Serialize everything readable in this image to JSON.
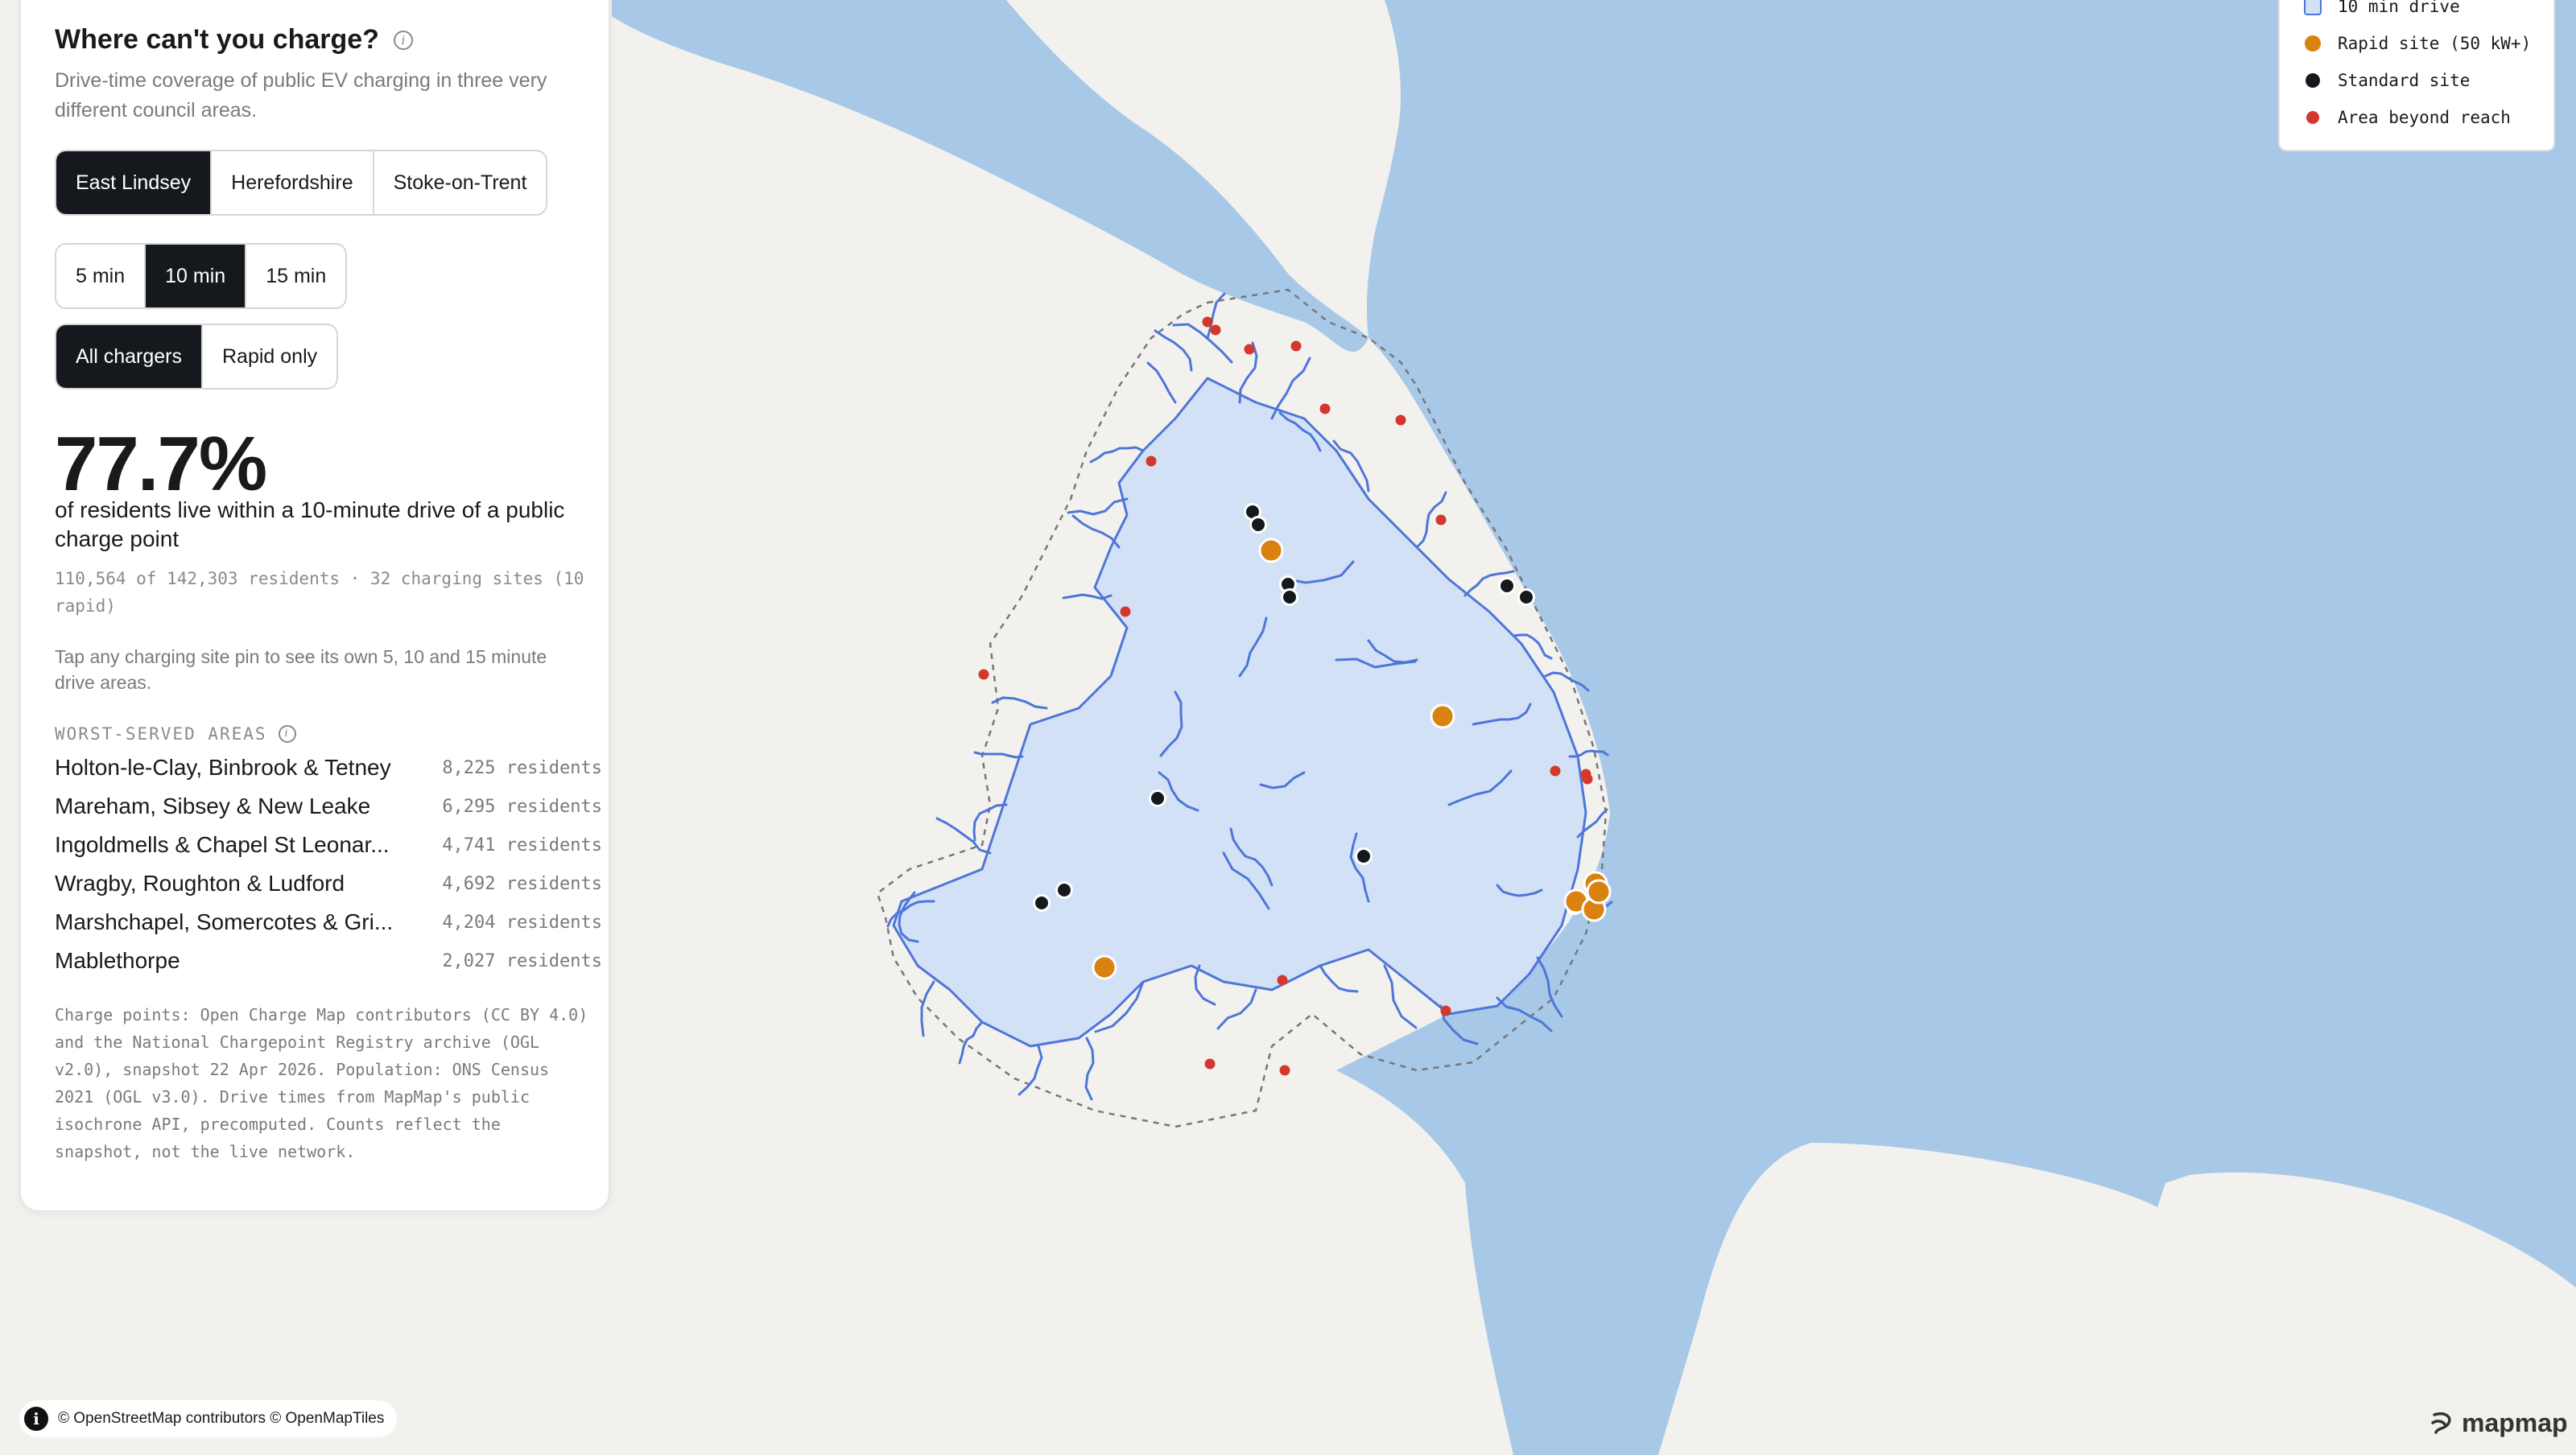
{
  "panel": {
    "title": "Where can't you charge?",
    "subtitle": "Drive-time coverage of public EV charging in three very different council areas.",
    "areas": [
      "East Lindsey",
      "Herefordshire",
      "Stoke-on-Trent"
    ],
    "selected_area": "East Lindsey",
    "durations": [
      "5 min",
      "10 min",
      "15 min"
    ],
    "selected_duration": "10 min",
    "charger_filters": [
      "All chargers",
      "Rapid only"
    ],
    "selected_filter": "All chargers",
    "stat": {
      "percent": "77.7%",
      "description": "of residents live within a 10-minute drive of a public charge point",
      "detail": "110,564 of 142,303 residents · 32 charging sites (10 rapid)"
    },
    "tap_note": "Tap any charging site pin to see its own 5, 10 and 15 minute drive areas.",
    "worst_served_heading": "WORST-SERVED AREAS",
    "worst_served": [
      {
        "name": "Holton-le-Clay, Binbrook & Tetney",
        "residents": "8,225 residents"
      },
      {
        "name": "Mareham, Sibsey & New Leake",
        "residents": "6,295 residents"
      },
      {
        "name": "Ingoldmells & Chapel St Leonar...",
        "residents": "4,741 residents"
      },
      {
        "name": "Wragby, Roughton & Ludford",
        "residents": "4,692 residents"
      },
      {
        "name": "Marshchapel, Somercotes & Gri...",
        "residents": "4,204 residents"
      },
      {
        "name": "Mablethorpe",
        "residents": "2,027 residents"
      }
    ],
    "source": "Charge points: Open Charge Map contributors (CC BY 4.0) and the National Chargepoint Registry archive (OGL v2.0), snapshot 22 Apr 2026. Population: ONS Census 2021 (OGL v3.0). Drive times from MapMap's public isochrone API, precomputed. Counts reflect the snapshot, not the live network."
  },
  "legend": {
    "items": [
      {
        "label": "10 min drive",
        "icon": "square-swatch",
        "color": "#d3e1f6"
      },
      {
        "label": "Rapid site (50 kW+)",
        "icon": "dot",
        "color": "#d9820f"
      },
      {
        "label": "Standard site",
        "icon": "dot",
        "color": "#15181d"
      },
      {
        "label": "Area beyond reach",
        "icon": "dot",
        "color": "#d4382c"
      }
    ]
  },
  "attribution": "© OpenStreetMap contributors © OpenMapTiles",
  "logo": "mapmap",
  "colors": {
    "land": "#f2f1ee",
    "water": "#a8c8e8",
    "coverage_fill": "#d3e1f6",
    "coverage_stroke": "#4e76d8",
    "rapid": "#d9820f",
    "standard": "#15181d",
    "beyond": "#d4382c"
  }
}
